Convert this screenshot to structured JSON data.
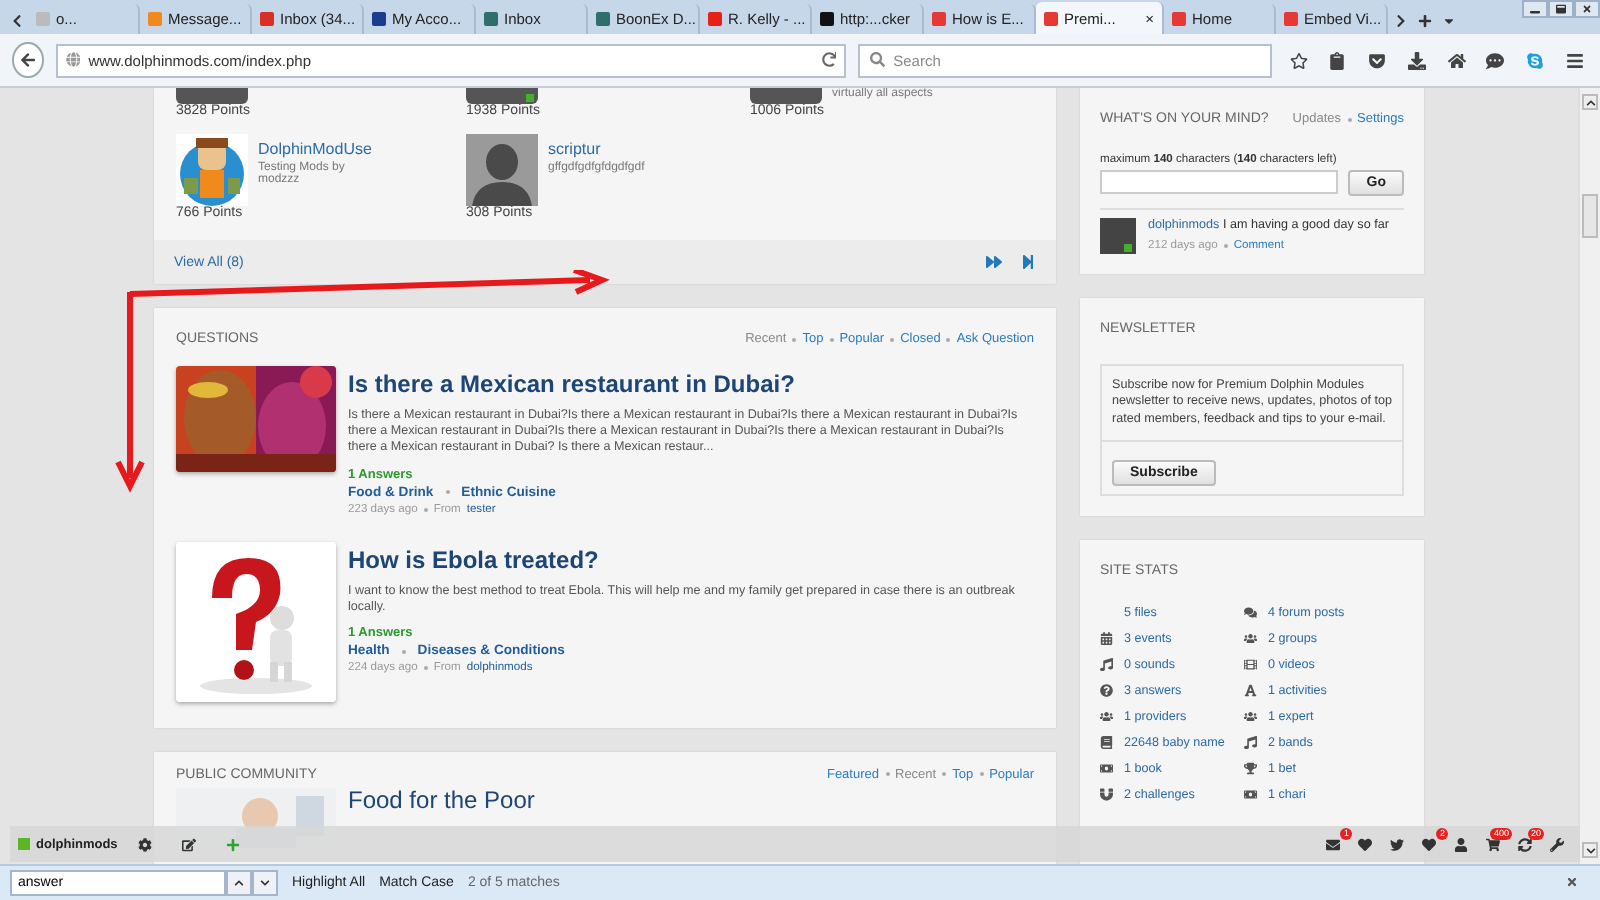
{
  "browser": {
    "tabs": [
      {
        "title": "o...",
        "kind": "blank",
        "selected": false
      },
      {
        "title": "Message...",
        "kind": "moodle",
        "selected": false
      },
      {
        "title": "Inbox (34...",
        "kind": "gmail",
        "selected": false
      },
      {
        "title": "My Acco...",
        "kind": "paypal",
        "selected": false
      },
      {
        "title": "Inbox",
        "kind": "boonex",
        "selected": false
      },
      {
        "title": "BoonEx D...",
        "kind": "boonex",
        "selected": false
      },
      {
        "title": "R. Kelly - ...",
        "kind": "youtube",
        "selected": false
      },
      {
        "title": "http:...cker",
        "kind": "code",
        "selected": false
      },
      {
        "title": "How is E...",
        "kind": "dolphin",
        "selected": false
      },
      {
        "title": "Premi...",
        "kind": "dolphin",
        "selected": true
      },
      {
        "title": "Home",
        "kind": "dolphin",
        "selected": false
      },
      {
        "title": "Embed Vi...",
        "kind": "dolphin",
        "selected": false
      }
    ],
    "close_mark": "×",
    "url": "www.dolphinmods.com/index.php",
    "search": {
      "placeholder": "Search"
    }
  },
  "members": {
    "top_row": [
      {
        "points": "3828 Points",
        "online": false
      },
      {
        "points": "1938 Points",
        "online": true
      },
      {
        "points": "1006 Points",
        "online": false,
        "caption": "virtually all aspects"
      }
    ],
    "rows": [
      {
        "name": "DolphinModUse",
        "caption": "Testing Mods by modzzz",
        "points": "766 Points",
        "kind": "picture"
      },
      {
        "name": "scriptur",
        "caption": "gffgdfgdfgfdgdfgdf",
        "points": "308 Points",
        "kind": "silhouette"
      }
    ],
    "view_all": "View All (8)"
  },
  "questions": {
    "title": "QUESTIONS",
    "links": [
      {
        "label": "Recent",
        "selected": true
      },
      {
        "label": "Top",
        "selected": false
      },
      {
        "label": "Popular",
        "selected": false
      },
      {
        "label": "Closed",
        "selected": false
      },
      {
        "label": "Ask Question",
        "selected": false
      }
    ],
    "items": [
      {
        "title": "Is there a Mexican restaurant in Dubai?",
        "body": "Is there a Mexican restaurant in Dubai?Is there a Mexican restaurant in Dubai?Is there a Mexican restaurant in Dubai?Is there a Mexican restaurant in Dubai?Is there a Mexican restaurant in Dubai?Is there a Mexican restaurant in Dubai?Is there a Mexican restaurant in Dubai? Is there a Mexican restaur...",
        "answers": "1 Answers",
        "category": "Food & Drink",
        "subcategory": "Ethnic Cuisine",
        "age": "223 days ago",
        "from": "From",
        "author": "tester"
      },
      {
        "kind": "question",
        "title": "How is Ebola treated?",
        "body": "I want to know the best method to treat Ebola. This will help me and my family get prepared in case there is an outbreak locally.",
        "answers": "1 Answers",
        "category": "Health",
        "subcategory": "Diseases & Conditions",
        "age": "224 days ago",
        "from": "From",
        "author": "dolphinmods"
      }
    ]
  },
  "public_community": {
    "title": "PUBLIC COMMUNITY",
    "links": [
      {
        "label": "Featured",
        "selected": false
      },
      {
        "label": "Recent",
        "selected": true
      },
      {
        "label": "Top",
        "selected": false
      },
      {
        "label": "Popular",
        "selected": false
      }
    ],
    "first_title": "Food for the Poor"
  },
  "mind": {
    "title": "WHAT'S ON YOUR MIND?",
    "links": [
      {
        "label": "Updates",
        "selected": true
      },
      {
        "label": "Settings",
        "selected": false
      }
    ],
    "limit": "maximum **140** characters (**140** characters left)",
    "button": "Go",
    "post": {
      "author": "dolphinmods",
      "online": true,
      "text": "I am having a good day so far",
      "age": "212 days ago",
      "comment": "Comment"
    }
  },
  "newsletter": {
    "title": "NEWSLETTER",
    "text": "Subscribe now for Premium Dolphin Modules newsletter to receive news, updates, photos of top rated members, feedback and tips to your e-mail.",
    "button": "Subscribe"
  },
  "stats": {
    "title": "SITE STATS",
    "items": [
      {
        "label": "5 files",
        "kind": "none"
      },
      {
        "label": "4 forum posts",
        "kind": "comments"
      },
      {
        "label": "3 events",
        "kind": "calendar"
      },
      {
        "label": "2 groups",
        "kind": "users"
      },
      {
        "label": "0 sounds",
        "kind": "music"
      },
      {
        "label": "0 videos",
        "kind": "film"
      },
      {
        "label": "3 answers",
        "kind": "question"
      },
      {
        "label": "1 activities",
        "kind": "font"
      },
      {
        "label": "1 providers",
        "kind": "users"
      },
      {
        "label": "1 expert",
        "kind": "users"
      },
      {
        "label": "22648 baby name",
        "kind": "book"
      },
      {
        "label": "2 bands",
        "kind": "music"
      },
      {
        "label": "1 book",
        "kind": "money"
      },
      {
        "label": "1 bet",
        "kind": "trophy"
      },
      {
        "label": "2 challenges",
        "kind": "magnet"
      },
      {
        "label": "1 chari",
        "kind": "money"
      }
    ]
  },
  "dolphin_bar": {
    "user": "dolphinmods",
    "icons": [
      {
        "kind": "mail",
        "badge": "1"
      },
      {
        "kind": "heart"
      },
      {
        "kind": "bird"
      },
      {
        "kind": "heart",
        "badge": "2"
      },
      {
        "kind": "user"
      },
      {
        "kind": "cart",
        "badge": "400"
      },
      {
        "kind": "sync",
        "badge": "20"
      },
      {
        "kind": "wrench"
      }
    ]
  },
  "find_bar": {
    "query": "answer",
    "highlight": "Highlight All",
    "match_case": "Match Case",
    "status": "2 of 5 matches"
  }
}
